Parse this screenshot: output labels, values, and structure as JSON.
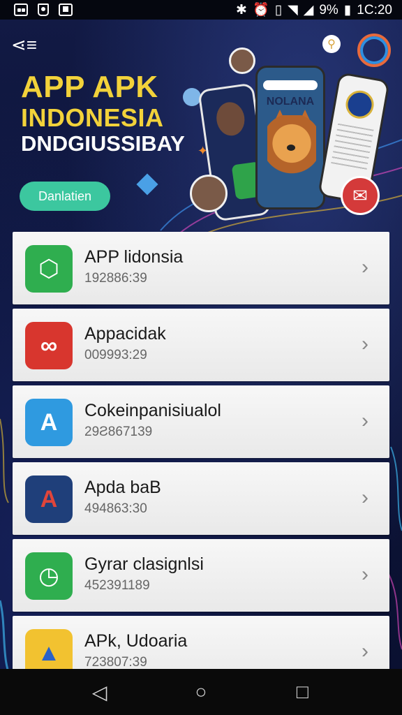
{
  "status_bar": {
    "battery": "9%",
    "time": "1C:20"
  },
  "header": {
    "title_line1": "APP APK",
    "title_line2": "INDONESIA",
    "title_line3": "DNDGIUSSIBAY",
    "download_button": "Danlatien",
    "phone_brand": "NOLANA"
  },
  "apps": [
    {
      "name": "APP lidonsia",
      "sub": "192886:39",
      "icon": "hexagon-icon",
      "color": "#2fae4f"
    },
    {
      "name": "Appacidak",
      "sub": "009993:29",
      "icon": "infinity-icon",
      "color": "#d8362e"
    },
    {
      "name": "Cokeinpanisiualol",
      "sub": "29Ƨ867139",
      "icon": "letter-a-icon",
      "color": "#2f9ae0"
    },
    {
      "name": "Apda baB",
      "sub": "494863:30",
      "icon": "letter-a-icon",
      "color": "#1f3f7a"
    },
    {
      "name": "Gyrar clasignlsi",
      "sub": "452391189",
      "icon": "clock-icon",
      "color": "#2fae4f"
    },
    {
      "name": "APk, Udoaria",
      "sub": "723807:39",
      "icon": "triangle-icon",
      "color": "#f2c230"
    }
  ],
  "nav": {
    "back_icon": "back-triangle-icon",
    "home_icon": "home-circle-icon",
    "recents_icon": "recents-square-icon"
  }
}
